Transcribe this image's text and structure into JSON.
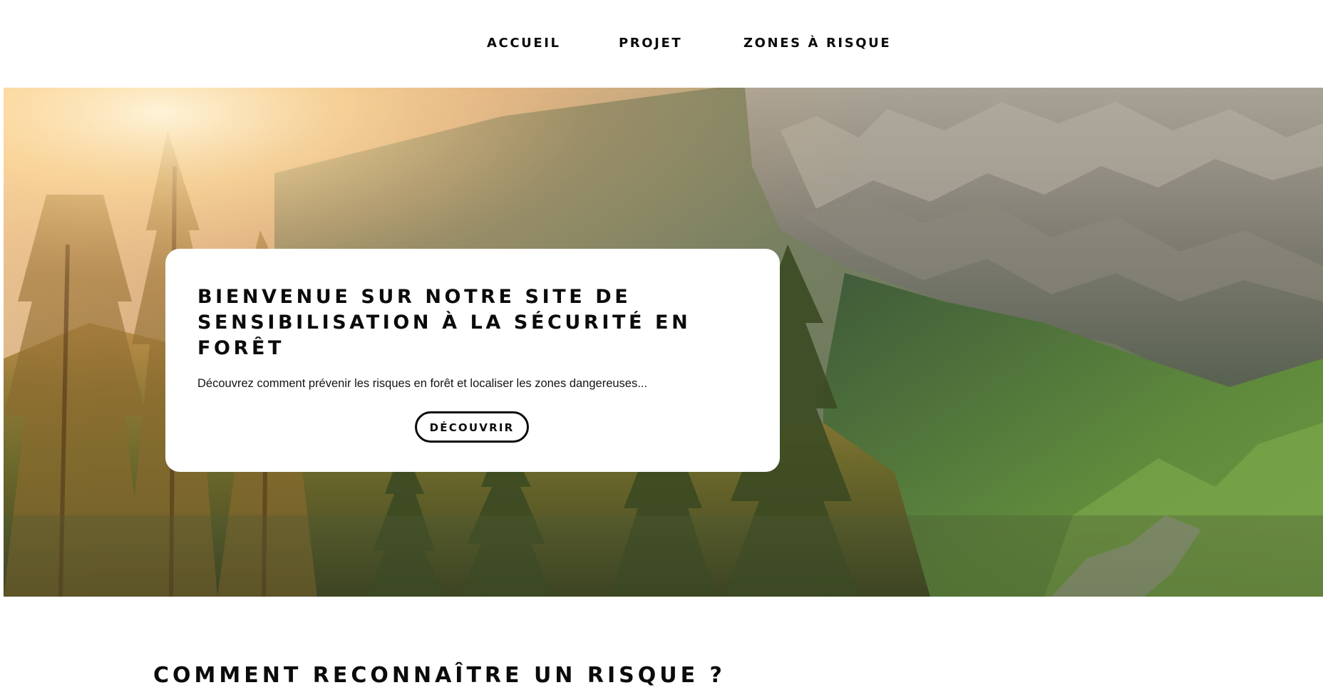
{
  "nav": {
    "items": [
      {
        "label": "ACCUEIL"
      },
      {
        "label": "PROJET"
      },
      {
        "label": "ZONES À RISQUE"
      }
    ]
  },
  "hero": {
    "image": "forest-cliff-sunlight-photo",
    "card": {
      "title": "BIENVENUE SUR NOTRE SITE DE SENSIBILISATION À LA SÉCURITÉ EN FORÊT",
      "text": "Découvrez comment prévenir les risques en forêt et localiser les zones dangereuses...",
      "button_label": "DÉCOUVRIR"
    }
  },
  "section": {
    "heading": "COMMENT RECONNAÎTRE UN RISQUE ?"
  },
  "colors": {
    "text": "#0b0b0b",
    "background": "#ffffff",
    "card": "#ffffff"
  }
}
